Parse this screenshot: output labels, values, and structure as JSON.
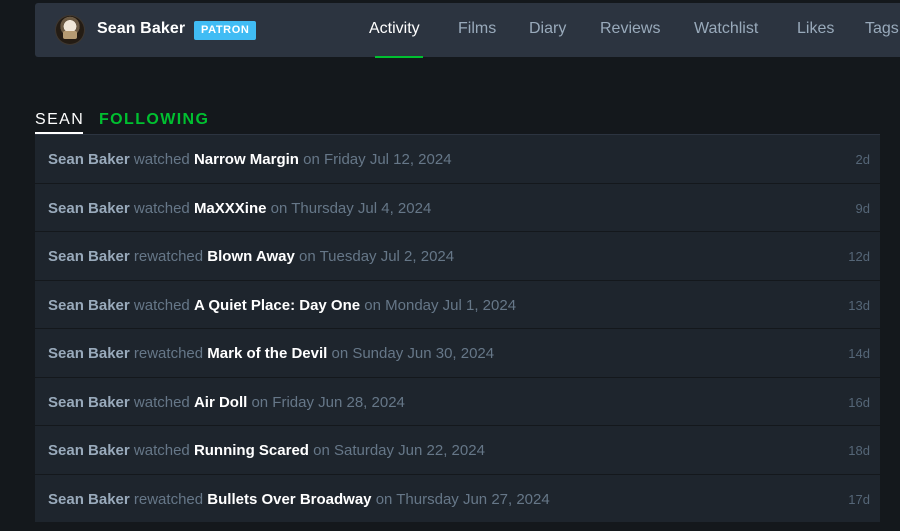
{
  "profile": {
    "name": "Sean Baker",
    "badge": "PATRON"
  },
  "nav": {
    "items": [
      {
        "label": "Activity",
        "active": true
      },
      {
        "label": "Films"
      },
      {
        "label": "Diary"
      },
      {
        "label": "Reviews"
      },
      {
        "label": "Watchlist"
      },
      {
        "label": "Likes"
      },
      {
        "label": "Tags"
      }
    ]
  },
  "subtabs": {
    "sean": "SEAN",
    "following": "FOLLOWING"
  },
  "activity": [
    {
      "user": "Sean Baker",
      "verb": "watched",
      "film": "Narrow Margin",
      "date": "on Friday Jul 12, 2024",
      "ago": "2d"
    },
    {
      "user": "Sean Baker",
      "verb": "watched",
      "film": "MaXXXine",
      "date": "on Thursday Jul 4, 2024",
      "ago": "9d"
    },
    {
      "user": "Sean Baker",
      "verb": "rewatched",
      "film": "Blown Away",
      "date": "on Tuesday Jul 2, 2024",
      "ago": "12d"
    },
    {
      "user": "Sean Baker",
      "verb": "watched",
      "film": "A Quiet Place: Day One",
      "date": "on Monday Jul 1, 2024",
      "ago": "13d"
    },
    {
      "user": "Sean Baker",
      "verb": "rewatched",
      "film": "Mark of the Devil",
      "date": "on Sunday Jun 30, 2024",
      "ago": "14d"
    },
    {
      "user": "Sean Baker",
      "verb": "watched",
      "film": "Air Doll",
      "date": "on Friday Jun 28, 2024",
      "ago": "16d"
    },
    {
      "user": "Sean Baker",
      "verb": "watched",
      "film": "Running Scared",
      "date": "on Saturday Jun 22, 2024",
      "ago": "18d"
    },
    {
      "user": "Sean Baker",
      "verb": "rewatched",
      "film": "Bullets Over Broadway",
      "date": "on Thursday Jun 27, 2024",
      "ago": "17d"
    }
  ],
  "colors": {
    "accent": "#00c030",
    "patron": "#40bcf4",
    "background": "#14181c",
    "row": "#1e252d",
    "header": "#2c3440"
  }
}
